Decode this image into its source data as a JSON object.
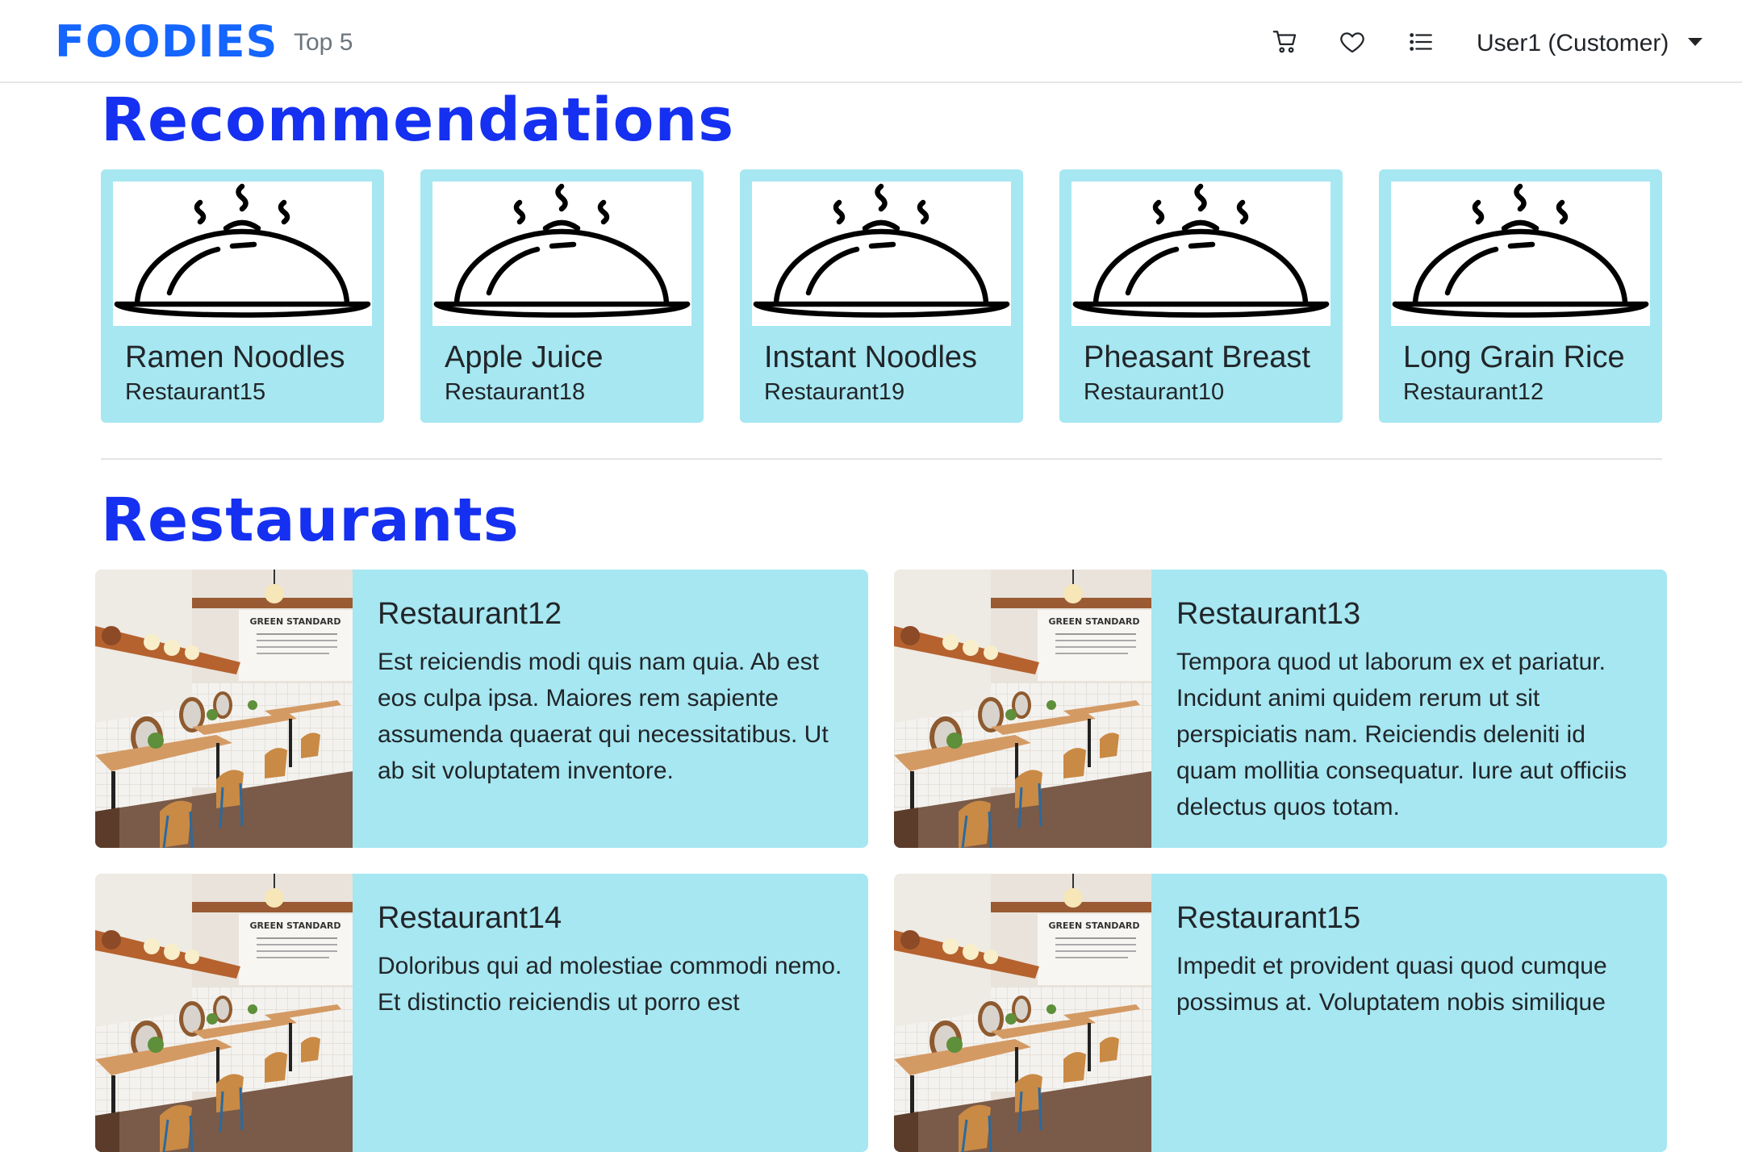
{
  "navbar": {
    "brand": "FOODIES",
    "link_top5": "Top 5",
    "user_label": "User1 (Customer)",
    "icons": [
      "cart-icon",
      "heart-icon",
      "list-icon"
    ]
  },
  "sections": {
    "recommendations_title": "Recommendations",
    "restaurants_title": "Restaurants"
  },
  "recommendations": [
    {
      "name": "Ramen Noodles",
      "restaurant": "Restaurant15"
    },
    {
      "name": "Apple Juice",
      "restaurant": "Restaurant18"
    },
    {
      "name": "Instant Noodles",
      "restaurant": "Restaurant19"
    },
    {
      "name": "Pheasant Breast",
      "restaurant": "Restaurant10"
    },
    {
      "name": "Long Grain Rice",
      "restaurant": "Restaurant12"
    }
  ],
  "restaurants": [
    {
      "name": "Restaurant12",
      "description": "Est reiciendis modi quis nam quia. Ab est eos culpa ipsa. Maiores rem sapiente assumenda quaerat qui necessitatibus. Ut ab sit voluptatem inventore.",
      "photo_sign": "GREEN STANDARD"
    },
    {
      "name": "Restaurant13",
      "description": "Tempora quod ut laborum ex et pariatur. Incidunt animi quidem rerum ut sit perspiciatis nam. Reiciendis deleniti id quam mollitia consequatur. Iure aut officiis delectus quos totam.",
      "photo_sign": "GREEN STANDARD"
    },
    {
      "name": "Restaurant14",
      "description": "Doloribus qui ad molestiae commodi nemo. Et distinctio reiciendis ut porro est",
      "photo_sign": "GREEN STANDARD"
    },
    {
      "name": "Restaurant15",
      "description": "Impedit et provident quasi quod cumque possimus at. Voluptatem nobis similique",
      "photo_sign": "GREEN STANDARD"
    }
  ],
  "colors": {
    "brand": "#1565ff",
    "heading": "#1530f0",
    "card_bg": "#a6e7f1"
  }
}
